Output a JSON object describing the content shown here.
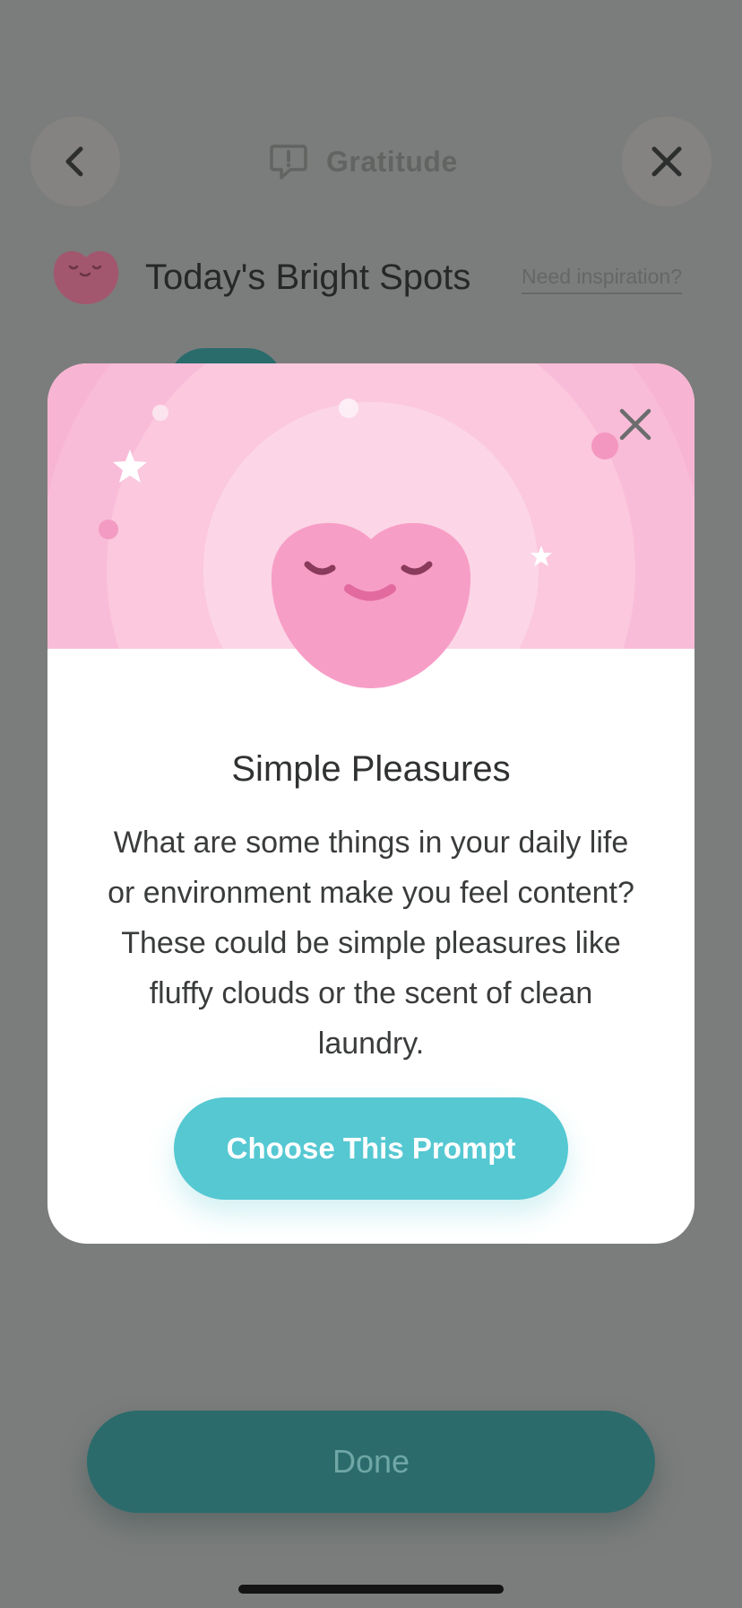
{
  "header": {
    "title": "Gratitude",
    "back_icon": "chevron-left-icon",
    "prompt_icon": "speech-bubble-exclamation-icon",
    "close_icon": "close-icon"
  },
  "entry": {
    "title": "Today's Bright Spots",
    "inspiration_link": "Need inspiration?"
  },
  "modal": {
    "title": "Simple Pleasures",
    "body": "What are some things in your daily life or environment make you feel content? These could be simple pleasures like fluffy clouds or the scent of clean laundry.",
    "cta_label": "Choose This Prompt",
    "close_icon": "close-icon",
    "colors": {
      "hero_bg": "#f8b5d3",
      "heart": "#f79ec7",
      "cta": "#55c8d2"
    }
  },
  "footer": {
    "done_label": "Done"
  }
}
